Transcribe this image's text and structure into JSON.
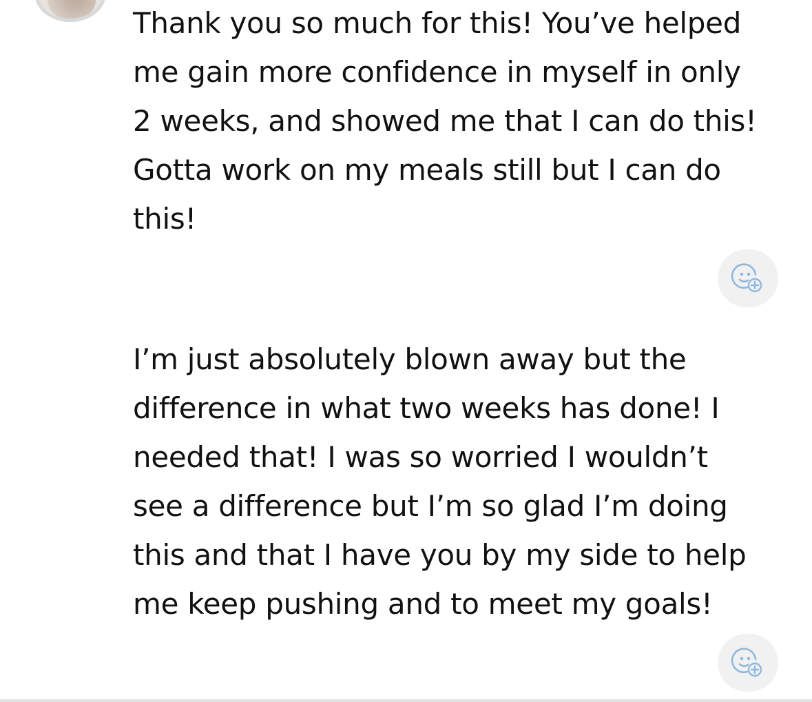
{
  "messages": [
    {
      "text": "Thank you so much for this! You’ve helped\nme gain more confidence in myself in only\n2 weeks, and showed me that I can do this!\nGotta work on my meals still but I can do\nthis!"
    },
    {
      "text": "I’m just absolutely blown away but the\ndifference in what two weeks has done! I\nneeded that! I was so worried I wouldn’t\nsee a difference but I’m so glad I’m doing\nthis and that I have you by my side to help\nme keep pushing and to meet my goals!"
    }
  ],
  "icons": {
    "avatar": "avatar",
    "reaction": "add-reaction-icon"
  },
  "colors": {
    "text": "#111111",
    "reaction_button_bg": "#f1f1f1",
    "reaction_icon": "#8fb8df",
    "divider": "#e4e4e4"
  }
}
